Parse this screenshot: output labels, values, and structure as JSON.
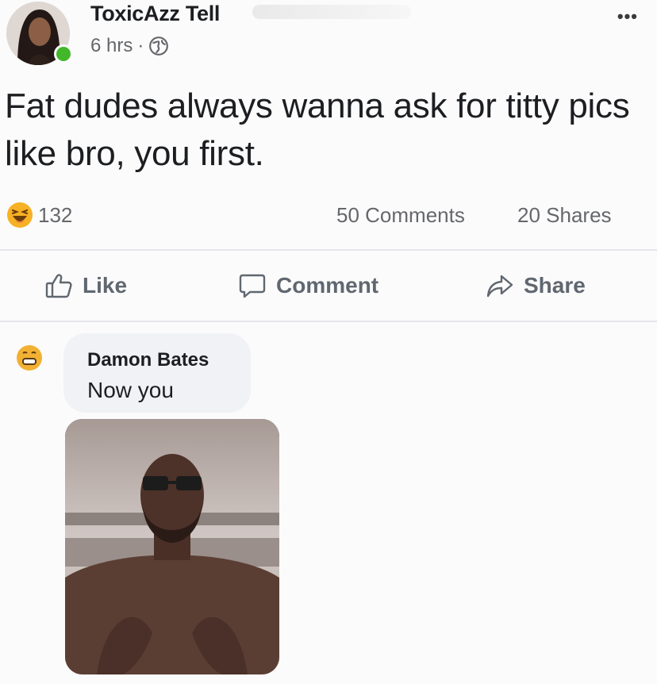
{
  "post": {
    "author": "ToxicAzz Tell",
    "time": "6 hrs",
    "meta_separator": "·",
    "privacy_icon": "globe-icon",
    "more_label": "•••",
    "text": "Fat dudes always wanna ask for titty pics like bro, you first."
  },
  "reactions": {
    "icon": "haha-icon",
    "count": "132",
    "comments": "50 Comments",
    "shares": "20 Shares"
  },
  "actions": {
    "like_label": "Like",
    "comment_label": "Comment",
    "share_label": "Share"
  },
  "comment": {
    "author": "Damon Bates",
    "text": "Now you",
    "avatar_icon": "grimace-icon",
    "photo": "selfie-photo"
  },
  "colors": {
    "text": "#1c1e21",
    "secondary_text": "#65676b",
    "online": "#42b72a",
    "bubble": "#f0f2f5",
    "reaction": "#f7b125"
  }
}
